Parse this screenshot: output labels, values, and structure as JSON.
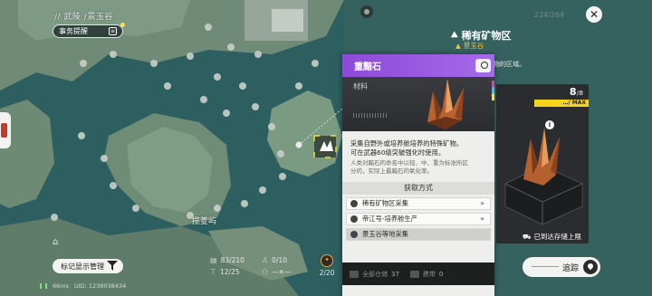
{
  "breadcrumb": "// 武陵 /景玉谷",
  "task_button": {
    "label": "事务提醒"
  },
  "map_labels": {
    "place": "揽菱屿"
  },
  "marker_button": {
    "label": "标记显示管理"
  },
  "status": {
    "ping": "66ms",
    "uid": "UID: 1238038434"
  },
  "stats": {
    "row1": {
      "a": "83/210",
      "b": "0/10"
    },
    "row2": {
      "a": "12/25",
      "b": "—✕—"
    }
  },
  "bag": {
    "count": "2/20"
  },
  "top_faint": "224/264",
  "area": {
    "title": "稀有矿物区",
    "subtitle": "景玉谷",
    "desc": "物的区域。"
  },
  "ore_card": {
    "count": "8",
    "cap": "/8",
    "max_label": "…/ MAX",
    "footer": "已到达存储上限"
  },
  "track_button": {
    "label": "追踪"
  },
  "item": {
    "name": "重黯石",
    "category": "材料",
    "desc_lines": [
      "采集自野外或培养舱培养的特殊矿物。",
      "可在武器60级突破强化时使用。"
    ],
    "faint_lines": [
      "人类对黯石的命名中以轻、中、重为标准所区",
      "分的，实际上最黯石的氧化率。"
    ],
    "section_title": "获取方式",
    "sources": [
      {
        "label": "稀有矿物区采集",
        "arrow": "»"
      },
      {
        "label": "帝江号-培养舱生产",
        "arrow": "»"
      },
      {
        "label": "景玉谷等地采集",
        "arrow": ""
      }
    ],
    "warehouse": {
      "label": "全部仓储",
      "count": "37",
      "carry_label": "携带",
      "carry_count": "0"
    }
  },
  "colors": {
    "accent_purple": "#8d4ad8",
    "gold": "#f3c13a",
    "max_yellow": "#f5d21b"
  }
}
